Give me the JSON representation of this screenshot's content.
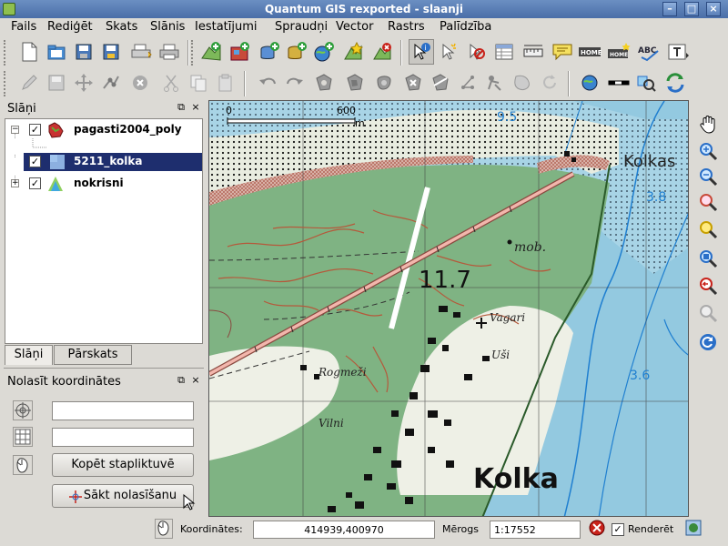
{
  "window": {
    "title": "Quantum GIS rexported - slaanji",
    "min": "–",
    "max": "□",
    "close": "×"
  },
  "menu": [
    "Fails",
    "Rediģēt",
    "Skats",
    "Slānis",
    "Iestatījumi",
    "Spraudņi",
    "Vector",
    "Rastrs",
    "Palīdzība"
  ],
  "toolbar1": {
    "icons": [
      "new-project-icon",
      "open-project-icon",
      "save-project-icon",
      "save-as-icon",
      "print-composer-icon",
      "print-icon",
      "add-vector-icon",
      "add-raster-icon",
      "add-postgis-icon",
      "add-spatialite-icon",
      "add-wms-icon",
      "new-vector-icon",
      "remove-layer-icon",
      "identify-icon",
      "select-icon",
      "deselect-icon",
      "attribute-table-icon",
      "measure-icon",
      "annotation-icon",
      "home-icon",
      "home-plus-icon",
      "spell-icon",
      "text-icon"
    ],
    "home_label": "HOME",
    "abc_label": "ABC"
  },
  "toolbar2": {
    "icons": [
      "toggle-edit-icon",
      "save-edits-icon",
      "move-feature-icon",
      "node-tool-icon",
      "delete-selected-icon",
      "cut-icon",
      "copy-icon",
      "paste-icon",
      "undo-icon",
      "redo-icon",
      "add-ring-icon",
      "add-island-icon",
      "delete-ring-icon",
      "delete-part-icon",
      "reshape-icon",
      "split-icon",
      "simplify-icon",
      "merge-icon",
      "rotate-icon",
      "refresh-icon",
      "gps-icon",
      "scale-bar-icon",
      "zoom-select-icon",
      "sync-icon"
    ]
  },
  "layers_panel": {
    "title": "Slāņi",
    "layers": [
      {
        "name": "pagasti2004_poly",
        "checked": true,
        "selected": false,
        "icon": "polygon-layer-icon"
      },
      {
        "name": "5211_kolka",
        "checked": true,
        "selected": true,
        "icon": "raster-layer-icon"
      },
      {
        "name": "nokrisni",
        "checked": true,
        "selected": false,
        "icon": "raster-layer-icon"
      }
    ],
    "tabs": [
      "Slāņi",
      "Pārskats"
    ]
  },
  "coords_panel": {
    "title": "Nolasīt koordinātes",
    "field1": "",
    "field2": "",
    "copy_button": "Kopēt stapliktuvē",
    "start_button": "Sākt nolasīšanu"
  },
  "map": {
    "scalebar": {
      "start": "0",
      "end": "600",
      "unit": "m"
    },
    "labels": {
      "kolkas": "Kolkas",
      "mob": "mob.",
      "height": "11.7",
      "vagari": "Vagari",
      "usi": "Uši",
      "rogmezi": "Rogmeži",
      "vilni": "Vilni",
      "kolka": "Kolka",
      "depth1": "9.5",
      "depth2": "3.8",
      "depth3": "3.6"
    },
    "colors": {
      "sea": "#93c9e0",
      "forest": "#7fb383",
      "coast": "#eef0e6",
      "contour": "#b5593b",
      "road": "#e8a0a0",
      "water_line": "#1f7fd0"
    }
  },
  "status": {
    "coords_label": "Koordinātes:",
    "coords_value": "414939,400970",
    "scale_label": "Mērogs",
    "scale_value": "1:17552",
    "render_label": "Renderēt",
    "render_checked": true
  }
}
